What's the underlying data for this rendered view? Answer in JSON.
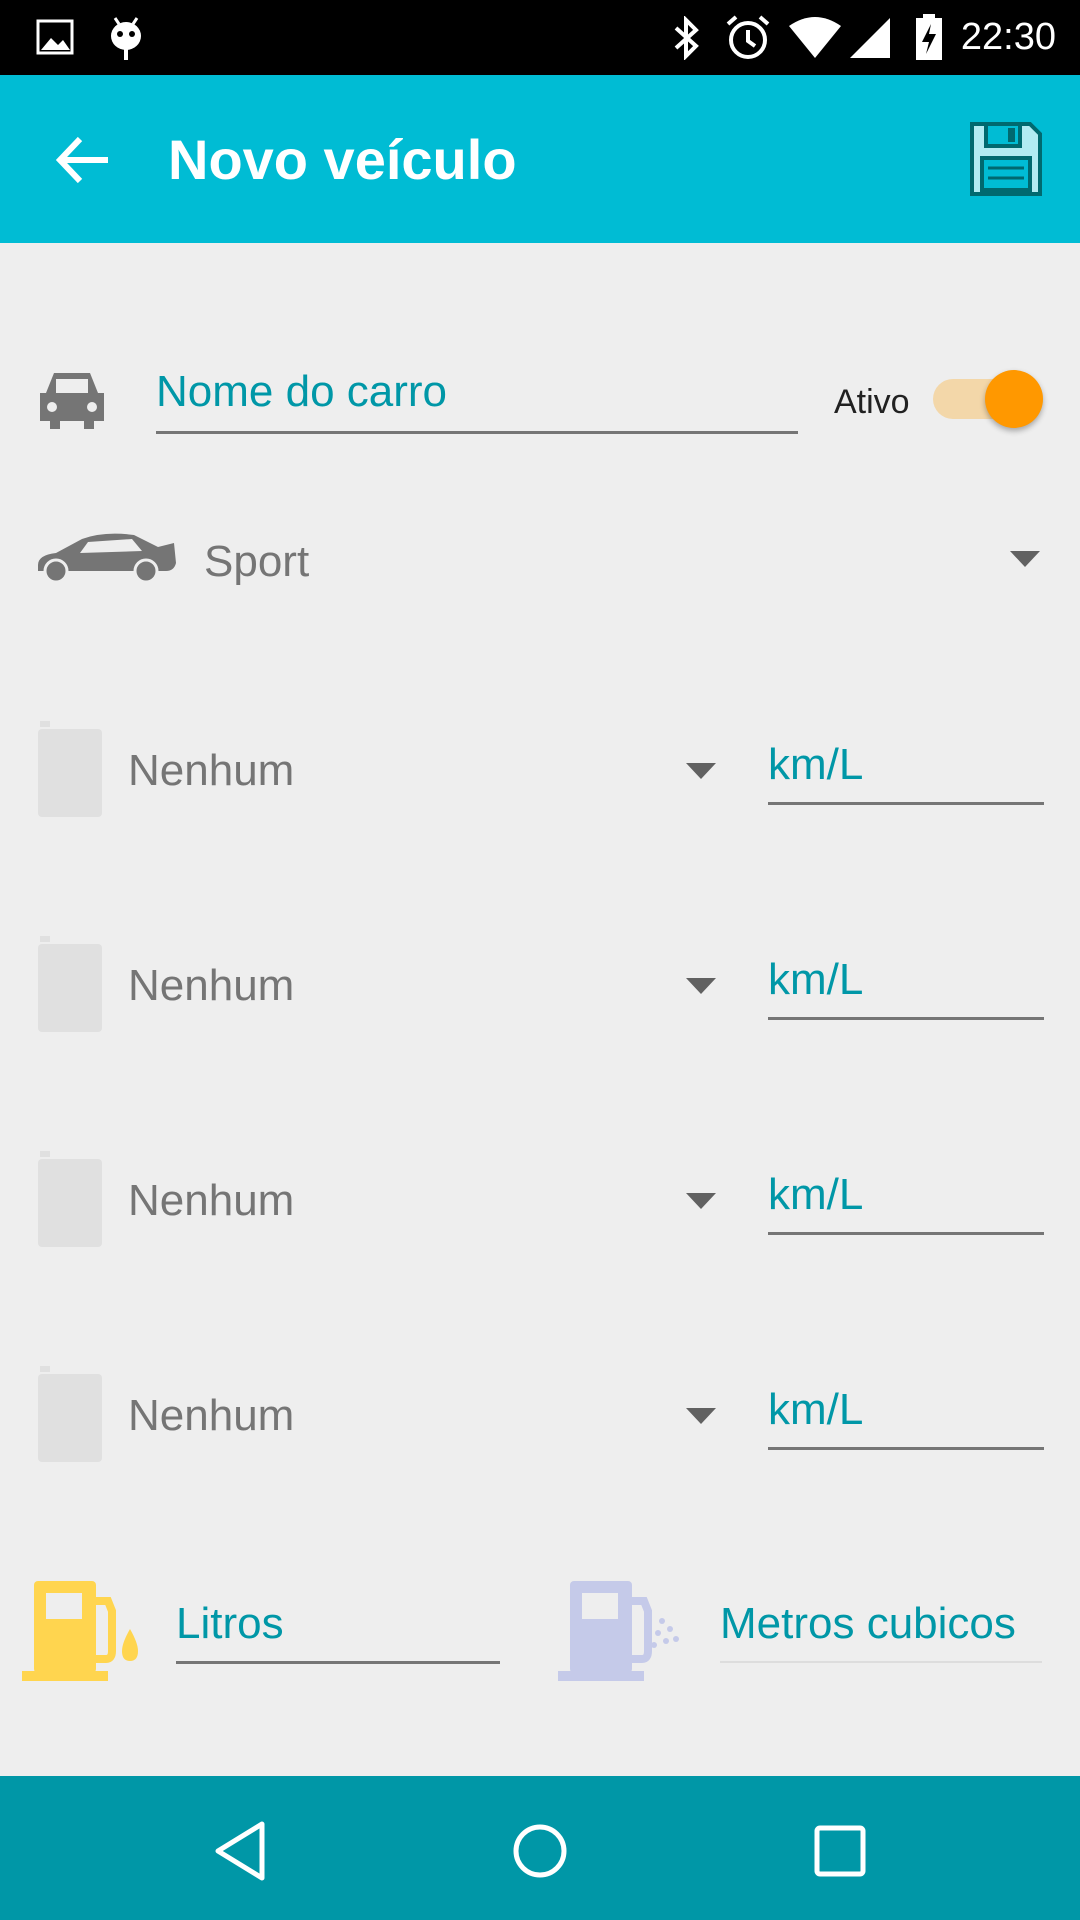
{
  "status_bar": {
    "time": "22:30",
    "icons": [
      "image-icon",
      "android-debug-icon",
      "bluetooth-icon",
      "alarm-icon",
      "wifi-icon",
      "signal-icon",
      "battery-charging-icon"
    ]
  },
  "app_bar": {
    "title": "Novo veículo",
    "back_icon": "arrow-back-icon",
    "save_icon": "floppy-disk-icon",
    "color": "#00bcd4"
  },
  "form": {
    "car_name": {
      "placeholder": "Nome do carro",
      "icon": "car-front-icon"
    },
    "active_switch": {
      "label": "Ativo",
      "on": true,
      "accent": "#ff9800"
    },
    "vehicle_type": {
      "value": "Sport",
      "icon": "sport-car-icon"
    },
    "fuel_rows": [
      {
        "fuel": "Nenhum",
        "consumption_placeholder": "km/L",
        "icon": "fuel-barrel-icon"
      },
      {
        "fuel": "Nenhum",
        "consumption_placeholder": "km/L",
        "icon": "fuel-barrel-icon"
      },
      {
        "fuel": "Nenhum",
        "consumption_placeholder": "km/L",
        "icon": "fuel-barrel-icon"
      },
      {
        "fuel": "Nenhum",
        "consumption_placeholder": "km/L",
        "icon": "fuel-barrel-icon"
      }
    ],
    "capacity": {
      "liters": {
        "placeholder": "Litros",
        "icon": "fuel-pump-liquid-icon",
        "color": "#ffd54f"
      },
      "cubic_meters": {
        "placeholder": "Metros cubicos",
        "icon": "fuel-pump-gas-icon",
        "color": "#c5cae9"
      }
    }
  },
  "nav_bar": {
    "buttons": [
      "back-triangle-icon",
      "home-circle-icon",
      "recents-square-icon"
    ],
    "color": "#0097a7"
  }
}
